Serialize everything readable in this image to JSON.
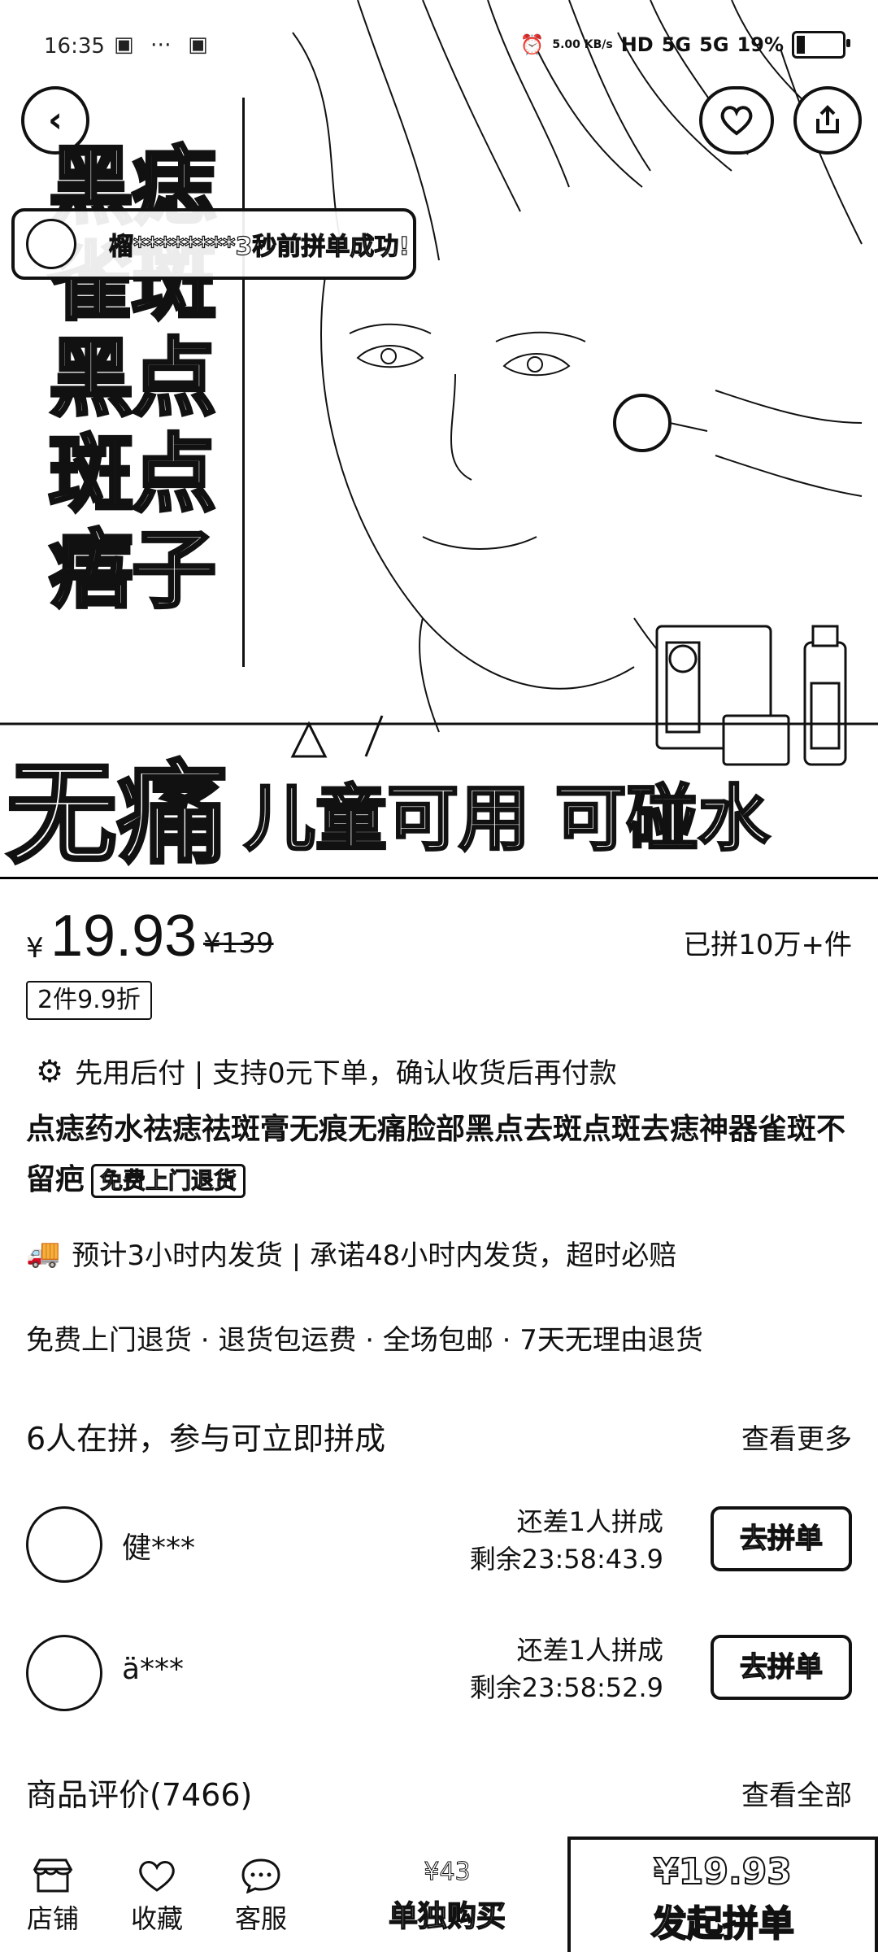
{
  "status_bar": {
    "time": "16:35",
    "sys_icons": "▣ ⋯ ▣",
    "net_speed": "5.00 KB/s",
    "hd": "HD",
    "sig1": "5G",
    "sig2": "5G",
    "battery": "19%"
  },
  "hero": {
    "back_icon": "‹",
    "chars": [
      "黑痣",
      "雀斑",
      "黑点",
      "斑点",
      "痦子"
    ],
    "toast": "榴********3秒前拼单成功!",
    "banner_big": "无痛",
    "banner_small": "儿童可用  可碰水"
  },
  "price": {
    "currency": "¥",
    "current": "19.93",
    "original": "¥139",
    "sold": "已拼10万+件",
    "discount_tag": "2件9.9折"
  },
  "pay_later": "先用后付 | 支持0元下单，确认收货后再付款",
  "product_title": "点痣药水祛痣祛斑膏无痕无痛脸部黑点去斑点斑去痣神器雀斑不留疤",
  "free_return_tag": "免费上门退货",
  "shipping": "预计3小时内发货 | 承诺48小时内发货，超时必赔",
  "services": "免费上门退货 · 退货包运费 · 全场包邮 · 7天无理由退货",
  "group": {
    "title": "6人在拼，参与可立即拼成",
    "more": "查看更多",
    "items": [
      {
        "name": "健***",
        "need": "还差1人拼成",
        "remain": "剩余23:58:43.9",
        "button": "去拼单"
      },
      {
        "name": "ä***",
        "need": "还差1人拼成",
        "remain": "剩余23:58:52.9",
        "button": "去拼单"
      }
    ]
  },
  "reviews": {
    "title": "商品评价(7466)",
    "all": "查看全部"
  },
  "bottom_bar": {
    "store": "店铺",
    "favorite": "收藏",
    "service": "客服",
    "single_price": "¥43",
    "single_label": "单独购买",
    "group_price": "¥19.93",
    "group_label": "发起拼单"
  }
}
